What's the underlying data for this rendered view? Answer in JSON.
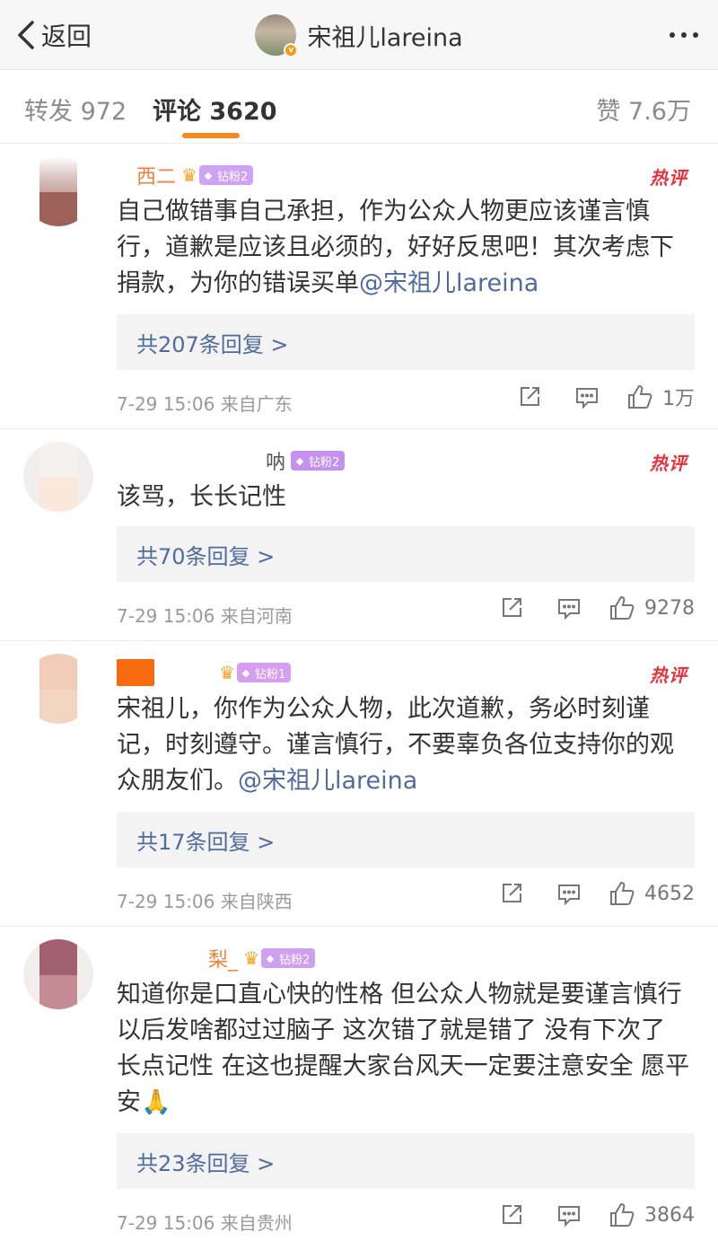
{
  "nav": {
    "back_label": "返回",
    "title": "宋祖儿lareina",
    "verified_mark": "v"
  },
  "tabs": {
    "forward": "转发 972",
    "comment": "评论 3620",
    "like": "赞 7.6万"
  },
  "colors": {
    "accent": "#f58b1f",
    "link": "#506b9e",
    "hot": "#e8333c"
  },
  "comments": [
    {
      "name": "西二",
      "crown_level": "6",
      "badge": "钻粉2",
      "hot": "热评",
      "text_plain": "自己做错事自己承担，作为公众人物更应该谨言慎行，道歉是应该且必须的，好好反思吧！其次考虑下捐款，为你的错误买单",
      "mention": "@宋祖儿lareina",
      "replies": "共207条回复 >",
      "time": "7-29 15:06",
      "location": "来自广东",
      "likes": "1万"
    },
    {
      "name": "呐",
      "badge": "钻粉2",
      "hot": "热评",
      "text_plain": "该骂，长长记性",
      "mention": "",
      "replies": "共70条回复 >",
      "time": "7-29 15:06",
      "location": "来自河南",
      "likes": "9278"
    },
    {
      "name": "",
      "crown_level": "3",
      "badge": "钻粉1",
      "hot": "热评",
      "text_plain": "宋祖儿，你作为公众人物，此次道歉，务必时刻谨记，时刻遵守。谨言慎行，不要辜负各位支持你的观众朋友们。",
      "mention": "@宋祖儿lareina",
      "replies": "共17条回复 >",
      "time": "7-29 15:06",
      "location": "来自陕西",
      "likes": "4652"
    },
    {
      "name": "梨_",
      "crown_level": "5",
      "badge": "钻粉2",
      "hot": "",
      "text_plain": "知道你是口直心快的性格 但公众人物就是要谨言慎行 以后发啥都过过脑子 这次错了就是错了 没有下次了 长点记性 在这也提醒大家台风天一定要注意安全 愿平安🙏",
      "mention": "",
      "replies": "共23条回复 >",
      "time": "7-29 15:06",
      "location": "来自贵州",
      "likes": "3864"
    }
  ]
}
